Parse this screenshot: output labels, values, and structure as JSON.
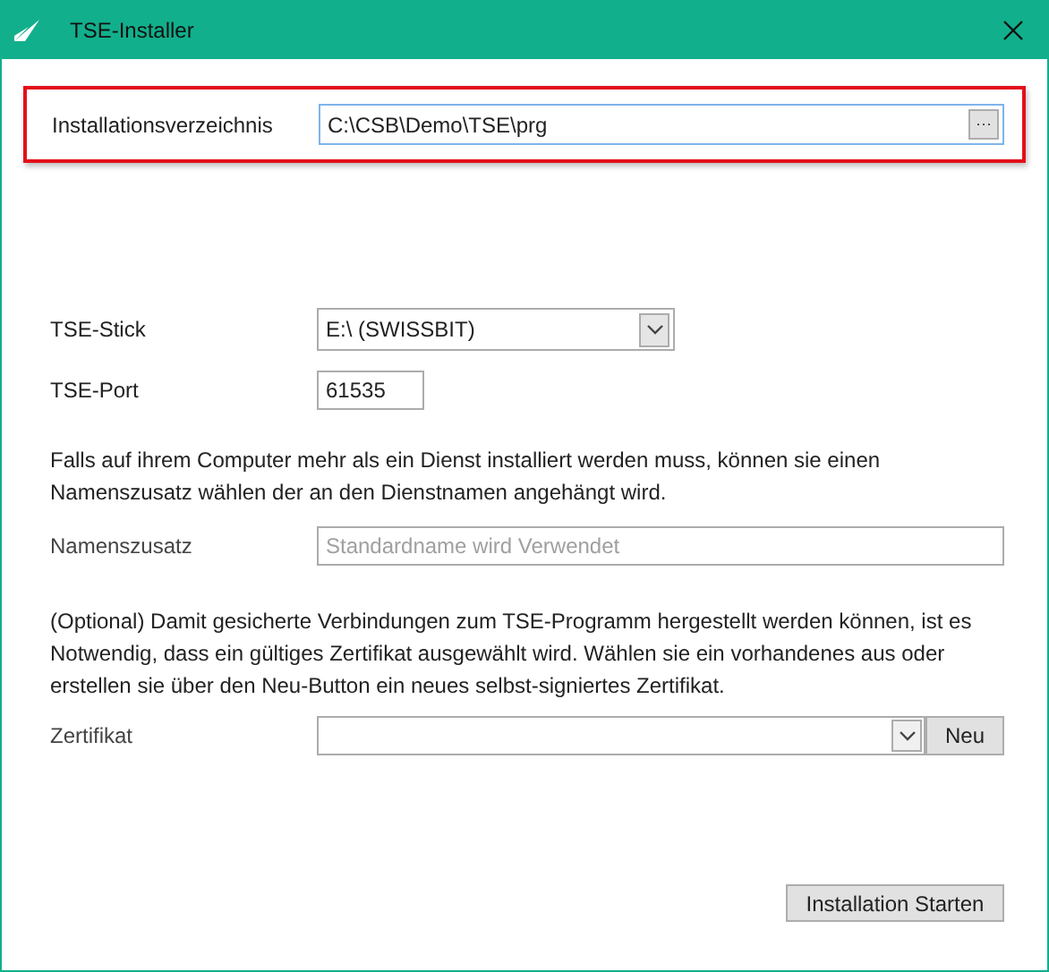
{
  "window": {
    "title": "TSE-Installer"
  },
  "install_dir": {
    "label": "Installationsverzeichnis",
    "value": "C:\\CSB\\Demo\\TSE\\prg",
    "browse": "···",
    "highlighted": true
  },
  "stick": {
    "label": "TSE-Stick",
    "value": "E:\\ (SWISSBIT)"
  },
  "port": {
    "label": "TSE-Port",
    "value": "61535"
  },
  "name_info": "Falls auf ihrem Computer mehr als ein Dienst installiert werden muss, können sie einen Namenszusatz wählen der an den Dienstnamen angehängt wird.",
  "name_suffix": {
    "label": "Namenszusatz",
    "placeholder": "Standardname wird Verwendet"
  },
  "cert_info": "(Optional) Damit gesicherte Verbindungen zum TSE-Programm hergestellt werden können, ist es Notwendig, dass ein gültiges Zertifikat ausgewählt wird. Wählen sie ein vorhandenes aus oder erstellen sie über den Neu-Button ein neues selbst-signiertes Zertifikat.",
  "certificate": {
    "label": "Zertifikat",
    "new_button": "Neu"
  },
  "start_button": "Installation Starten"
}
